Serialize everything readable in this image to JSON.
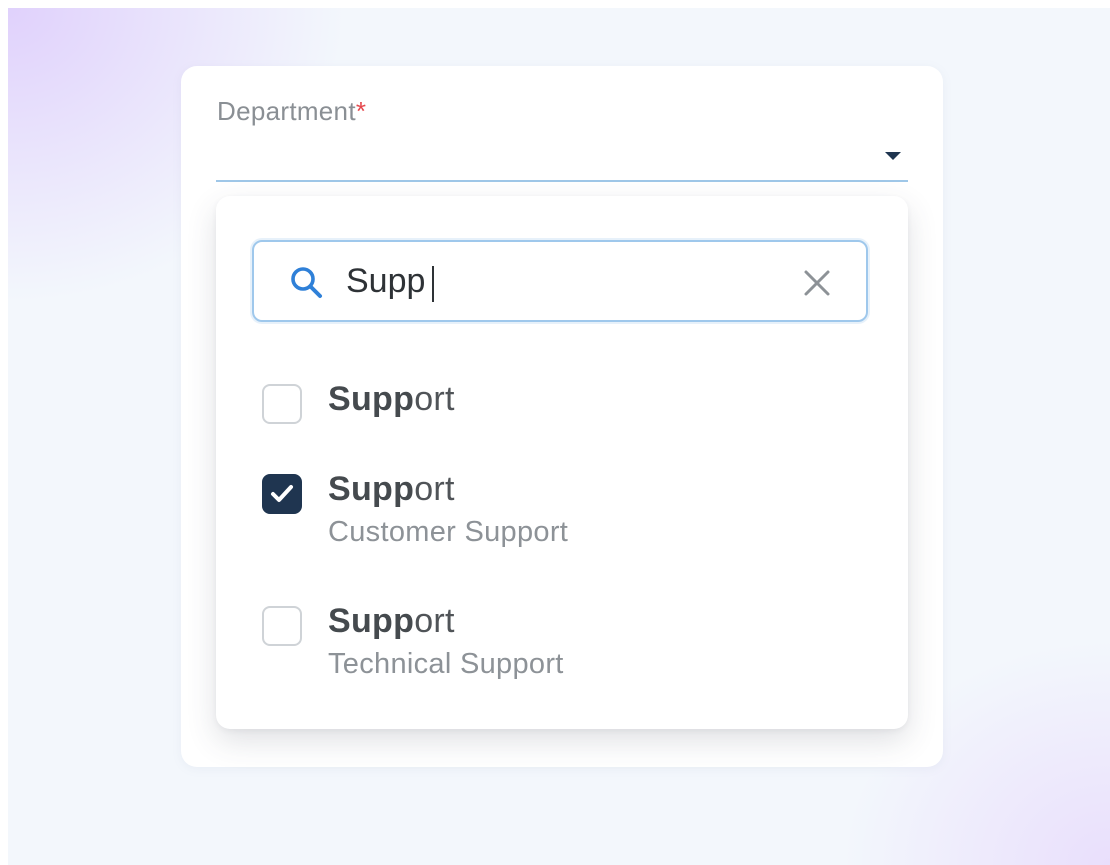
{
  "field": {
    "label": "Department",
    "required_marker": "*"
  },
  "search": {
    "value": "Supp",
    "placeholder": ""
  },
  "options": [
    {
      "match": "Supp",
      "rest": "ort",
      "subtitle": "",
      "checked": false
    },
    {
      "match": "Supp",
      "rest": "ort",
      "subtitle": "Customer Support",
      "checked": true
    },
    {
      "match": "Supp",
      "rest": "ort",
      "subtitle": "Technical Support",
      "checked": false
    }
  ],
  "icons": {
    "dropdown": "caret-down-icon",
    "search": "search-icon",
    "clear": "close-icon",
    "check": "check-icon"
  },
  "colors": {
    "accent": "#1f3550",
    "focus_border": "#9fc8ec",
    "search_icon": "#2f80d8",
    "required": "#e5484d"
  }
}
